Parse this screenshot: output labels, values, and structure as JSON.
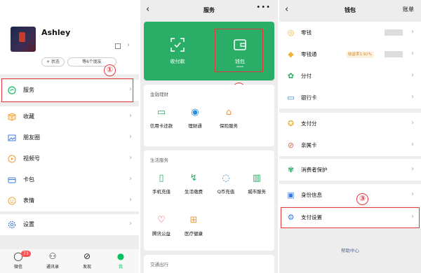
{
  "me_screen": {
    "username": "Ashley",
    "status_btn": "+ 状态",
    "friends_btn": "等6个朋友",
    "menu": [
      {
        "label": "服务",
        "icon": "service-icon",
        "color": "#07c160"
      },
      {
        "label": "收藏",
        "icon": "favorites-icon",
        "color": "#f2a435"
      },
      {
        "label": "朋友圈",
        "icon": "moments-icon",
        "color": "#3f7bd9"
      },
      {
        "label": "视频号",
        "icon": "channels-icon",
        "color": "#f19a38"
      },
      {
        "label": "卡包",
        "icon": "cards-icon",
        "color": "#3f7bd9"
      },
      {
        "label": "表情",
        "icon": "stickers-icon",
        "color": "#f2a435"
      },
      {
        "label": "设置",
        "icon": "settings-icon",
        "color": "#3f7bd9"
      }
    ],
    "tabs": [
      {
        "label": "微信",
        "icon": "chat-icon",
        "badge": "73"
      },
      {
        "label": "通讯录",
        "icon": "contacts-icon"
      },
      {
        "label": "发现",
        "icon": "discover-icon"
      },
      {
        "label": "我",
        "icon": "me-icon",
        "active": true
      }
    ]
  },
  "service_screen": {
    "title": "服务",
    "pay": {
      "label": "收付款",
      "icon": "scan-pay-icon"
    },
    "wallet": {
      "label": "钱包",
      "sub": "****",
      "icon": "wallet-icon"
    },
    "finance": {
      "title": "金融理财",
      "items": [
        {
          "label": "信用卡还款",
          "icon": "credit-card-icon"
        },
        {
          "label": "理财通",
          "icon": "wealth-icon"
        },
        {
          "label": "保险服务",
          "icon": "insurance-icon"
        }
      ]
    },
    "life": {
      "title": "生活服务",
      "items": [
        {
          "label": "手机充值",
          "icon": "phone-topup-icon"
        },
        {
          "label": "生活缴费",
          "icon": "utilities-icon"
        },
        {
          "label": "Q币充值",
          "icon": "qcoin-icon"
        },
        {
          "label": "城市服务",
          "icon": "city-service-icon"
        },
        {
          "label": "腾讯公益",
          "icon": "charity-icon"
        },
        {
          "label": "医疗健康",
          "icon": "health-icon"
        }
      ]
    },
    "travel_title": "交通出行"
  },
  "wallet_screen": {
    "title": "钱包",
    "bill": "账单",
    "rows": [
      {
        "label": "零钱",
        "icon": "change-icon",
        "color": "#f2b233"
      },
      {
        "label": "零钱通",
        "icon": "change-plus-icon",
        "color": "#f2b233",
        "tag": "收益率1.92%"
      },
      {
        "label": "分付",
        "icon": "fenfu-icon",
        "color": "#2aae67"
      },
      {
        "label": "银行卡",
        "icon": "bank-card-icon",
        "color": "#3f7bd9"
      },
      {
        "label": "支付分",
        "icon": "pay-score-icon",
        "color": "#f2b233"
      },
      {
        "label": "亲属卡",
        "icon": "family-card-icon",
        "color": "#e5663a"
      },
      {
        "label": "消费者保护",
        "icon": "consumer-protect-icon",
        "color": "#2aae67"
      },
      {
        "label": "身份信息",
        "icon": "identity-icon",
        "color": "#3f7bd9"
      },
      {
        "label": "支付设置",
        "icon": "pay-settings-icon",
        "color": "#3f7bd9"
      }
    ],
    "help": "帮助中心"
  },
  "annotations": [
    "①",
    "②",
    "③"
  ]
}
